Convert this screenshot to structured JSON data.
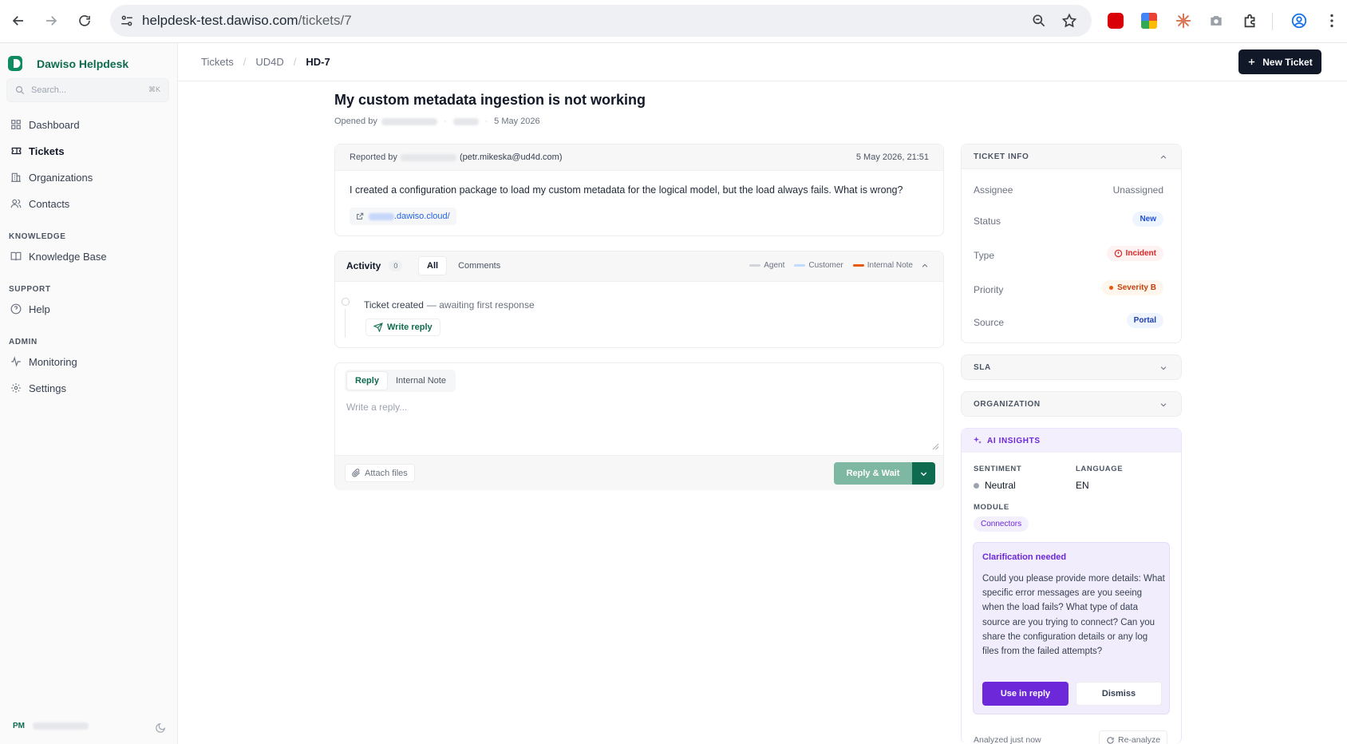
{
  "browser": {
    "url_domain": "helpdesk-test.dawiso.com",
    "url_path": "/tickets/7"
  },
  "sidebar": {
    "brand": "Dawiso Helpdesk",
    "search_placeholder": "Search...",
    "search_shortcut": "⌘K",
    "items": [
      {
        "label": "Dashboard",
        "icon": "dashboard-icon"
      },
      {
        "label": "Tickets",
        "icon": "ticket-icon"
      },
      {
        "label": "Organizations",
        "icon": "building-icon"
      },
      {
        "label": "Contacts",
        "icon": "users-icon"
      }
    ],
    "sections": {
      "knowledge": "KNOWLEDGE",
      "support": "SUPPORT",
      "admin": "ADMIN"
    },
    "knowledge_items": [
      {
        "label": "Knowledge Base",
        "icon": "book-icon"
      }
    ],
    "support_items": [
      {
        "label": "Help",
        "icon": "help-icon"
      }
    ],
    "admin_items": [
      {
        "label": "Monitoring",
        "icon": "activity-icon"
      },
      {
        "label": "Settings",
        "icon": "gear-icon"
      }
    ],
    "user_initials": "PM"
  },
  "breadcrumb": {
    "items": [
      "Tickets",
      "UD4D",
      "HD-7"
    ]
  },
  "header": {
    "new_ticket": "New Ticket"
  },
  "ticket": {
    "title": "My custom metadata ingestion is not working",
    "opened_by": "Opened by",
    "opened_date": "5 May 2026",
    "reported_by": "Reported by",
    "reporter_email": "(petr.mikeska@ud4d.com)",
    "reported_at": "5 May 2026, 21:51",
    "body": "I created a configuration package to load my custom metadata for the logical model, but the load always fails. What is wrong?",
    "link": ".dawiso.cloud/"
  },
  "activity": {
    "label": "Activity",
    "count": "0",
    "tabs": [
      "All",
      "Comments"
    ],
    "legend": [
      {
        "label": "Agent",
        "color": "#d1d5db"
      },
      {
        "label": "Customer",
        "color": "#bfdbfe"
      },
      {
        "label": "Internal Note",
        "color": "#ea580c"
      }
    ],
    "event_title": "Ticket created",
    "event_sub": "— awaiting first response",
    "write_reply": "Write reply"
  },
  "reply": {
    "tabs": [
      "Reply",
      "Internal Note"
    ],
    "placeholder": "Write a reply...",
    "attach": "Attach files",
    "submit": "Reply & Wait"
  },
  "ticket_info": {
    "title": "TICKET INFO",
    "assignee_label": "Assignee",
    "assignee": "Unassigned",
    "status_label": "Status",
    "status": "New",
    "type_label": "Type",
    "type": "Incident",
    "priority_label": "Priority",
    "priority": "Severity B",
    "source_label": "Source",
    "source": "Portal"
  },
  "sla": {
    "title": "SLA"
  },
  "organization": {
    "title": "ORGANIZATION"
  },
  "ai": {
    "title": "AI INSIGHTS",
    "sentiment_label": "SENTIMENT",
    "sentiment": "Neutral",
    "language_label": "LANGUAGE",
    "language": "EN",
    "module_label": "MODULE",
    "module": "Connectors",
    "clar_title": "Clarification needed",
    "clar_text": "Could you please provide more details: What specific error messages are you seeing when the load fails? What type of data source are you trying to connect? Can you share the configuration details or any log files from the failed attempts?",
    "use_in_reply": "Use in reply",
    "dismiss": "Dismiss",
    "analyzed": "Analyzed just now",
    "reanalyze": "Re-analyze"
  }
}
